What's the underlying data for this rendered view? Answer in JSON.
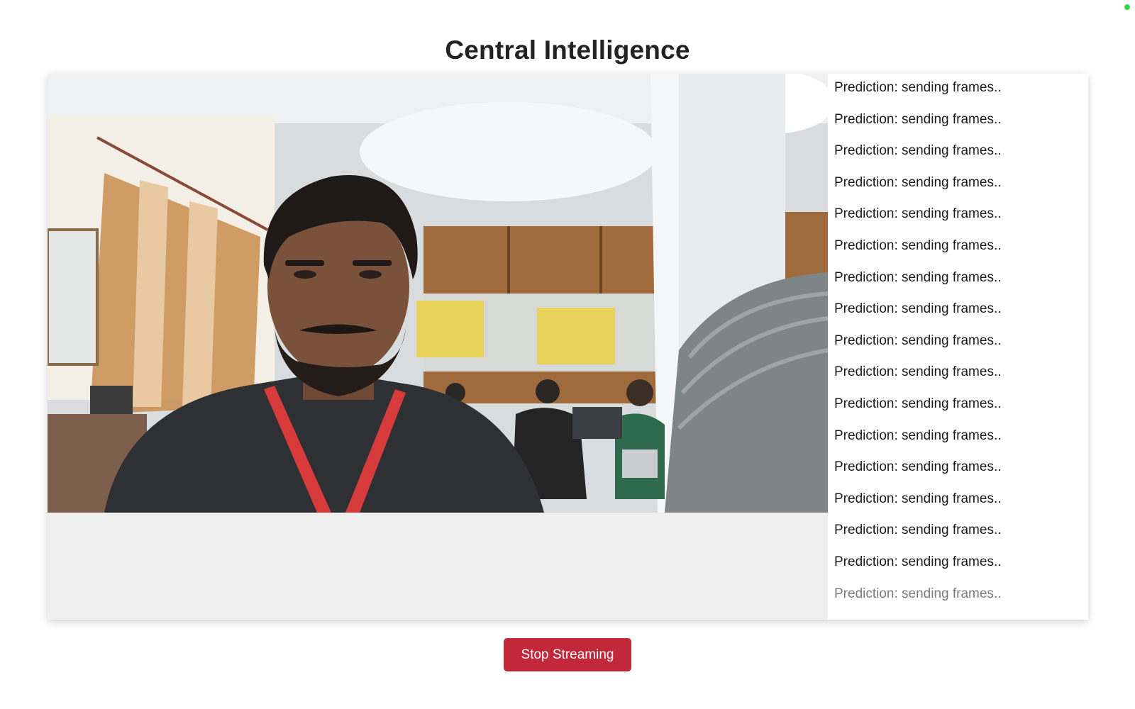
{
  "page": {
    "title": "Central Intelligence"
  },
  "stream": {
    "video_description_icon": "webcam-video-frame",
    "predictions": [
      "Prediction: sending frames..",
      "Prediction: sending frames..",
      "Prediction: sending frames..",
      "Prediction: sending frames..",
      "Prediction: sending frames..",
      "Prediction: sending frames..",
      "Prediction: sending frames..",
      "Prediction: sending frames..",
      "Prediction: sending frames..",
      "Prediction: sending frames..",
      "Prediction: sending frames..",
      "Prediction: sending frames..",
      "Prediction: sending frames..",
      "Prediction: sending frames..",
      "Prediction: sending frames..",
      "Prediction: sending frames..",
      "Prediction: sending frames.."
    ]
  },
  "controls": {
    "stop_label": "Stop Streaming",
    "stop_color": "#c1283a"
  },
  "colors": {
    "status_dot": "#3ad14f"
  }
}
